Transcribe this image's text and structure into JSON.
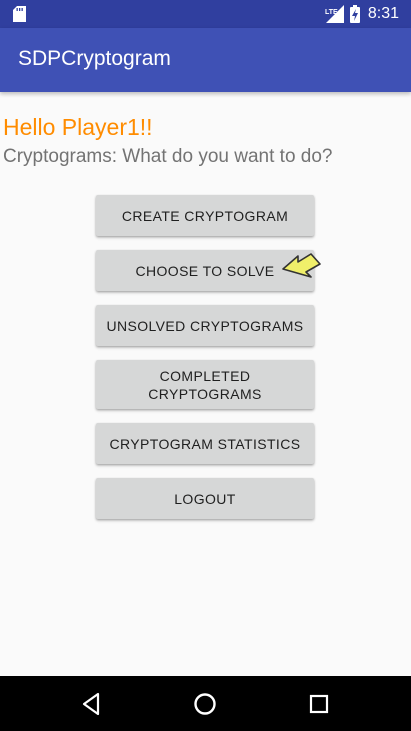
{
  "status_bar": {
    "time": "8:31",
    "network_label": "LTE",
    "icons": [
      "sd-card-icon",
      "lte-signal-icon",
      "battery-charging-icon"
    ]
  },
  "app_bar": {
    "title": "SDPCryptogram"
  },
  "main": {
    "greeting": "Hello Player1!!",
    "prompt": "Cryptograms: What do you want to do?",
    "greeting_color": "#ff8c00",
    "buttons": [
      {
        "label": "CREATE CRYPTOGRAM"
      },
      {
        "label": "CHOOSE TO SOLVE"
      },
      {
        "label": "UNSOLVED CRYPTOGRAMS"
      },
      {
        "label": "COMPLETED CRYPTOGRAMS"
      },
      {
        "label": "CRYPTOGRAM STATISTICS"
      },
      {
        "label": "LOGOUT"
      }
    ]
  },
  "nav_bar": {
    "icons": [
      "back-icon",
      "home-icon",
      "recents-icon"
    ]
  },
  "colors": {
    "status_bar": "#303f9f",
    "app_bar": "#3f51b5",
    "button_bg": "#d6d7d7",
    "cursor": "#f0ef6a"
  }
}
